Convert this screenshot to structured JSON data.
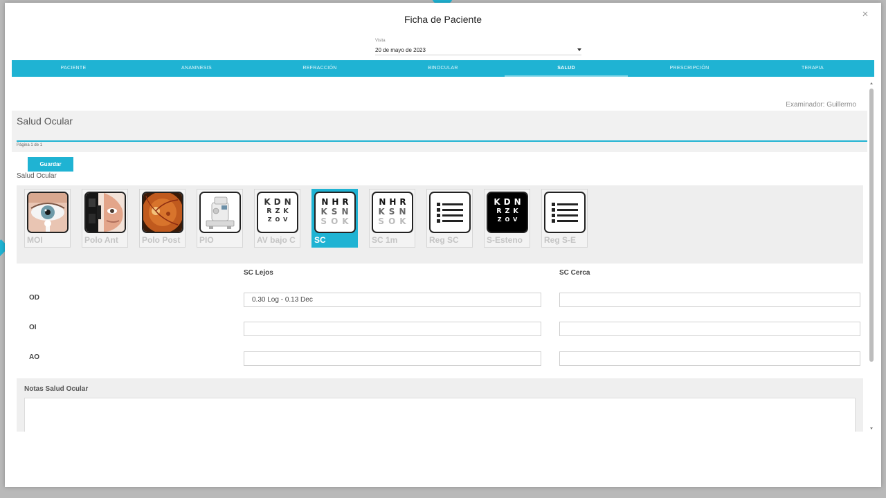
{
  "modal": {
    "title": "Ficha de Paciente",
    "close_icon": "×"
  },
  "visit": {
    "label": "Visita",
    "value": "20 de mayo de 2023"
  },
  "tabs": [
    {
      "label": "PACIENTE",
      "active": false
    },
    {
      "label": "ANAMNESIS",
      "active": false
    },
    {
      "label": "REFRACCIÓN",
      "active": false
    },
    {
      "label": "BINOCULAR",
      "active": false
    },
    {
      "label": "SALUD",
      "active": true
    },
    {
      "label": "PRESCRIPCIÓN",
      "active": false
    },
    {
      "label": "TERAPIA",
      "active": false
    }
  ],
  "content": {
    "examiner": "Examinador: Guillermo",
    "section_title": "Salud Ocular",
    "page_label": "Página 1 de 1",
    "save_label": "Guardar",
    "sub_title": "Salud Ocular"
  },
  "tiles": [
    {
      "label": "MOI",
      "icon": "eye-photo-icon"
    },
    {
      "label": "Polo Ant",
      "icon": "slit-lamp-photo-icon"
    },
    {
      "label": "Polo Post",
      "icon": "retina-photo-icon"
    },
    {
      "label": "PIO",
      "icon": "tonometer-icon"
    },
    {
      "label": "AV bajo C",
      "icon": "snellen-chart-icon",
      "chart": [
        "KDN",
        "RZK",
        "ZOV"
      ]
    },
    {
      "label": "SC",
      "icon": "snellen-chart-icon",
      "chart": [
        "NHR",
        "KSN",
        "SOK"
      ],
      "selected": true
    },
    {
      "label": "SC 1m",
      "icon": "snellen-chart-icon",
      "chart": [
        "NHR",
        "KSN",
        "SOK"
      ]
    },
    {
      "label": "Reg SC",
      "icon": "list-icon"
    },
    {
      "label": "S-Esteno",
      "icon": "snellen-chart-dark-icon",
      "chart": [
        "KDN",
        "RZK",
        "ZOV"
      ]
    },
    {
      "label": "Reg S-E",
      "icon": "list-icon"
    }
  ],
  "table": {
    "col_lejos": "SC Lejos",
    "col_cerca": "SC Cerca",
    "rows": [
      {
        "label": "OD",
        "lejos": "0.30 Log - 0.13 Dec",
        "cerca": ""
      },
      {
        "label": "OI",
        "lejos": "",
        "cerca": ""
      },
      {
        "label": "AO",
        "lejos": "",
        "cerca": ""
      }
    ]
  },
  "notes": {
    "title": "Notas Salud Ocular",
    "value": ""
  },
  "colors": {
    "accent": "#1fb3d3",
    "panel": "#eeeeee"
  }
}
